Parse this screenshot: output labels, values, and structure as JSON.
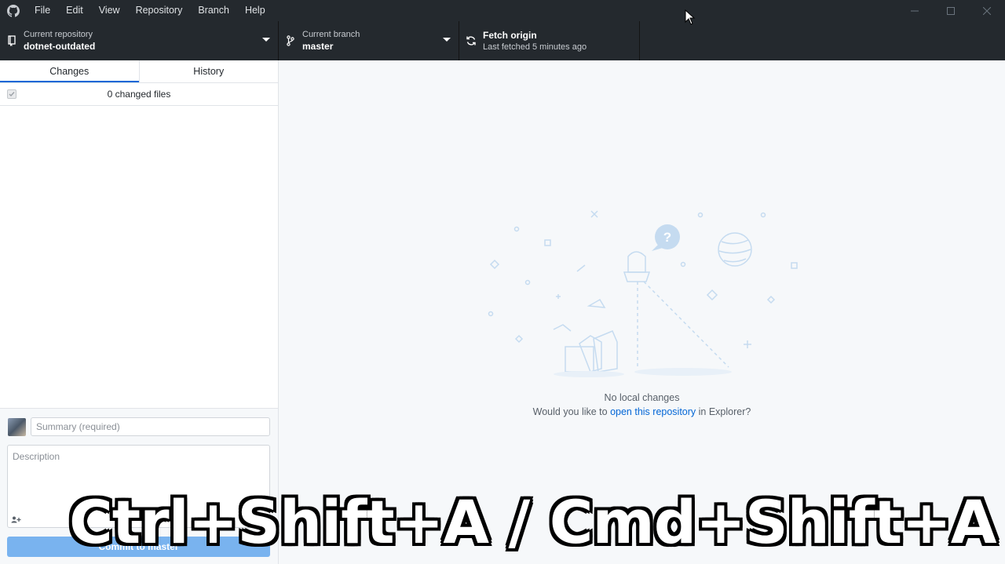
{
  "menu": {
    "logo_icon": "github-octocat-icon",
    "items": [
      "File",
      "Edit",
      "View",
      "Repository",
      "Branch",
      "Help"
    ]
  },
  "toolbar": {
    "repo": {
      "label": "Current repository",
      "value": "dotnet-outdated",
      "icon": "repo-icon"
    },
    "branch": {
      "label": "Current branch",
      "value": "master",
      "icon": "git-branch-icon"
    },
    "fetch": {
      "label": "Fetch origin",
      "value": "Last fetched 5 minutes ago",
      "icon": "sync-icon"
    }
  },
  "sidebar": {
    "tabs": [
      "Changes",
      "History"
    ],
    "active_tab": "Changes",
    "changed_files": "0 changed files"
  },
  "commit": {
    "summary_placeholder": "Summary (required)",
    "description_placeholder": "Description",
    "button_label": "Commit to master"
  },
  "main": {
    "no_changes": "No local changes",
    "prompt_before": "Would you like to ",
    "prompt_link": "open this repository",
    "prompt_after": " in Explorer?"
  },
  "caption": "Ctrl+Shift+A / Cmd+Shift+A",
  "colors": {
    "titlebar": "#24292e",
    "accent": "#0366d6",
    "commit_button": "#79b3ef",
    "main_bg": "#f6f8fa"
  }
}
